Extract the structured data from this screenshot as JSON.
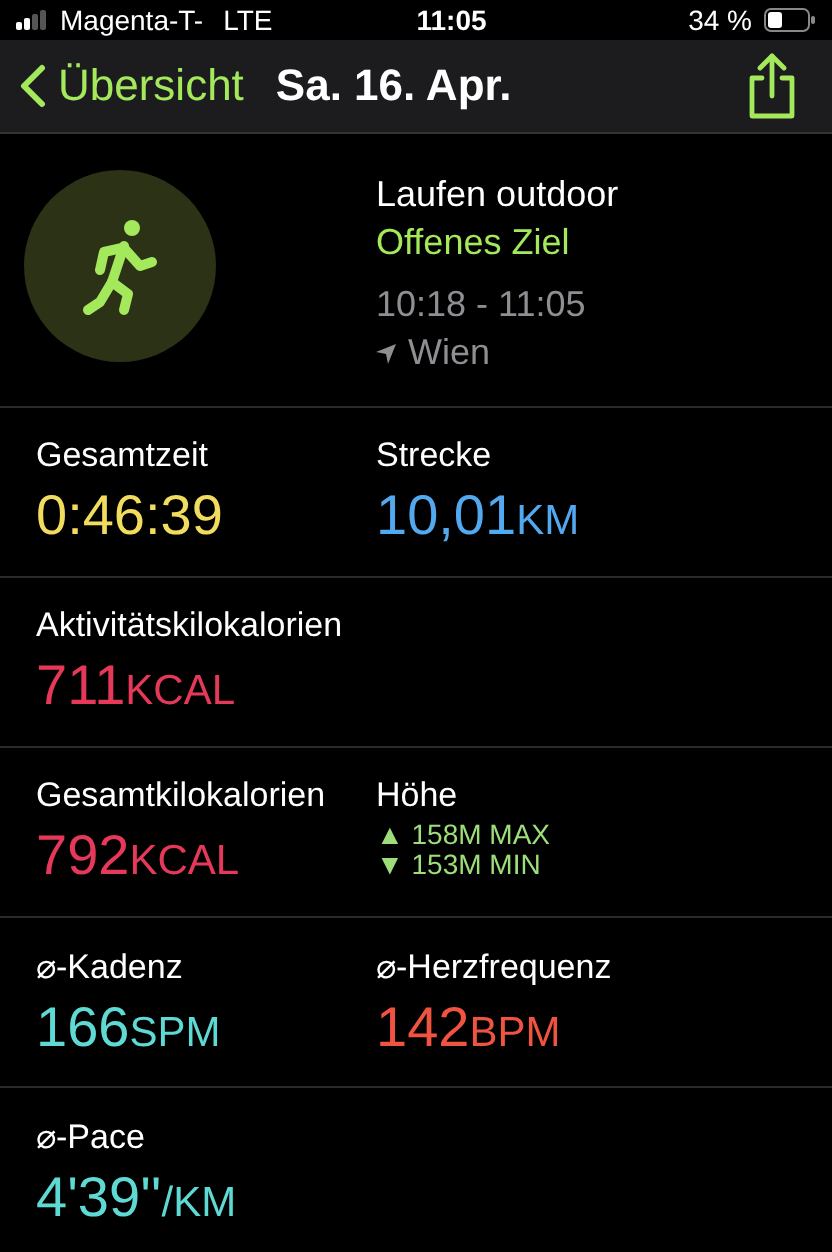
{
  "status_bar": {
    "carrier": "Magenta-T-",
    "network": "LTE",
    "time": "11:05",
    "battery": "34 %"
  },
  "nav": {
    "back": "Übersicht",
    "title": "Sa. 16. Apr."
  },
  "workout": {
    "name": "Laufen outdoor",
    "goal": "Offenes Ziel",
    "time_range": "10:18 - 11:05",
    "location": "Wien"
  },
  "rows": [
    {
      "cells": [
        {
          "kind": "metric",
          "label": "Gesamtzeit",
          "value": "0:46:39",
          "color": "#f2dc5d"
        },
        {
          "kind": "metric",
          "label": "Strecke",
          "value": "10,01",
          "unit": "KM",
          "color": "#52a9f0"
        }
      ]
    },
    {
      "cells": [
        {
          "kind": "metric",
          "label": "Aktivitätskilokalorien",
          "value": "711",
          "unit": "KCAL",
          "color": "#e6395a"
        }
      ]
    },
    {
      "cells": [
        {
          "kind": "metric",
          "label": "Gesamtkilokalorien",
          "value": "792",
          "unit": "KCAL",
          "color": "#e6395a"
        },
        {
          "kind": "elevation",
          "label": "Höhe",
          "lines": [
            {
              "arrow": "▲",
              "text": "158M MAX"
            },
            {
              "arrow": "▼",
              "text": "153M MIN"
            }
          ],
          "color": "#9ede7a"
        }
      ]
    },
    {
      "cells": [
        {
          "kind": "metric",
          "label": "⌀-Kadenz",
          "value": "166",
          "unit": "SPM",
          "color": "#5fd9d3"
        },
        {
          "kind": "metric",
          "label": "⌀-Herzfrequenz",
          "value": "142",
          "unit": "BPM",
          "color": "#f0533f"
        }
      ]
    },
    {
      "cells": [
        {
          "kind": "metric",
          "label": "⌀-Pace",
          "value": "4'39''",
          "unit": "/KM",
          "color": "#5fd9d3"
        }
      ]
    }
  ]
}
